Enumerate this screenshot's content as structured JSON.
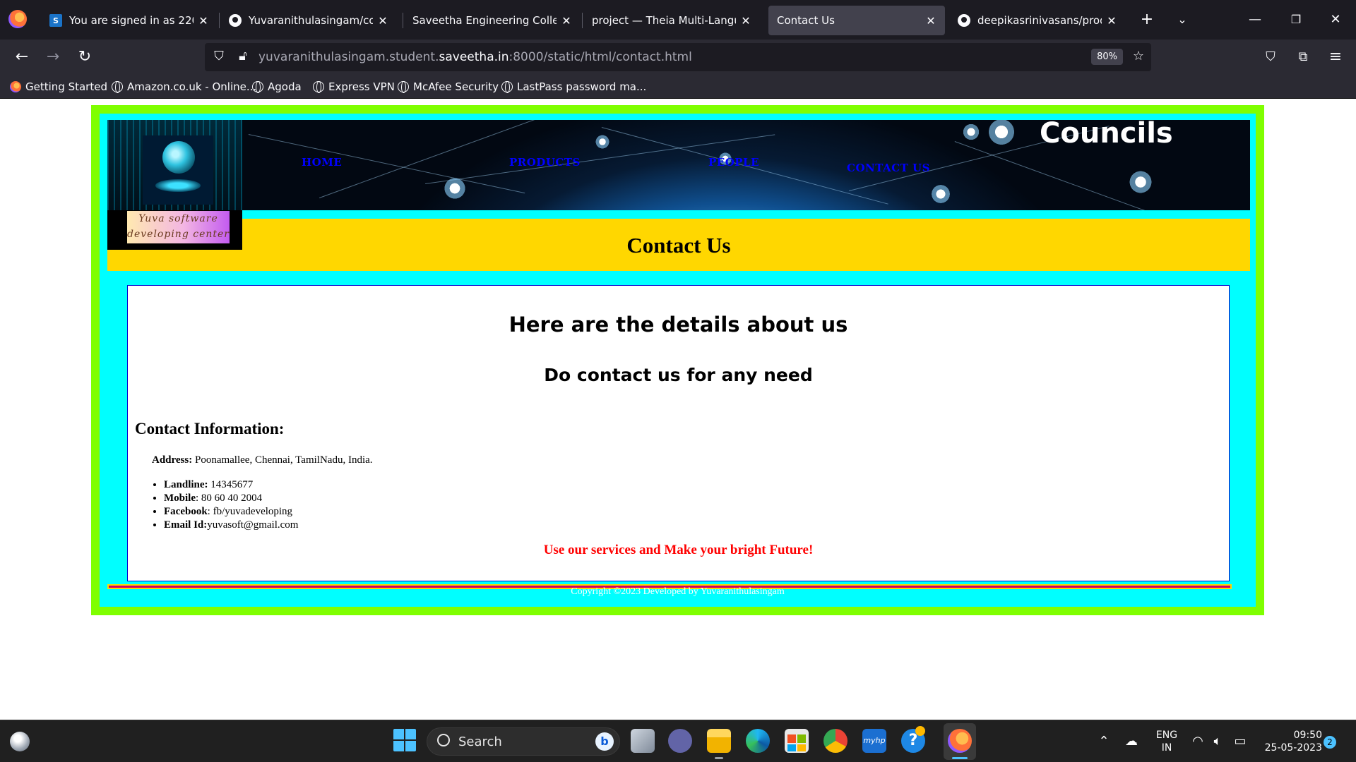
{
  "browser": {
    "tabs": [
      {
        "title": "You are signed in as 220090",
        "icon": "s-icon"
      },
      {
        "title": "Yuvaranithulasingam/cover",
        "icon": "github-icon"
      },
      {
        "title": "Saveetha Engineering College",
        "icon": "none"
      },
      {
        "title": "project — Theia Multi-Language",
        "icon": "none"
      },
      {
        "title": "Contact Us",
        "icon": "none"
      },
      {
        "title": "deepikasrinivasans/product",
        "icon": "github-icon"
      }
    ],
    "active_tab_index": 4,
    "url_prefix": "yuvaranithulasingam.student.",
    "url_domain": "saveetha.in",
    "url_suffix": ":8000/static/html/contact.html",
    "zoom": "80%",
    "bookmarks": [
      "Getting Started",
      "Amazon.co.uk - Online...",
      "Agoda",
      "Express VPN",
      "McAfee Security",
      "LastPass password ma..."
    ]
  },
  "page": {
    "banner_word": "Councils",
    "nav": {
      "home": "HOME",
      "products": "PRODUCTS",
      "people": "PEOPLE",
      "contact": "CONTACT US"
    },
    "logo_text_line1": "Yuva software",
    "logo_text_line2": "developing center",
    "title": "Contact Us",
    "heading": "Here are the details about us",
    "subheading": "Do contact us for any need",
    "contact_heading": "Contact Information:",
    "address_label": "Address:",
    "address_value": " Poonamallee, Chennai, TamilNadu, India.",
    "contacts": [
      {
        "label": "Landline:",
        "value": " 14345677"
      },
      {
        "label": "Mobile",
        "value": ": 80 60 40 2004"
      },
      {
        "label": "Facebook",
        "value": ": fb/yuvadeveloping"
      },
      {
        "label": "Email Id:",
        "value": "yuvasoft@gmail.com"
      }
    ],
    "tagline": "Use our services and Make your bright Future!",
    "copyright": "Copyright ©2023 Developed by Yuvaranithulasingam"
  },
  "taskbar": {
    "search_label": "Search",
    "lang_line1": "ENG",
    "lang_line2": "IN",
    "time": "09:50",
    "date": "25-05-2023",
    "notifications": "2"
  },
  "colors": {
    "outer_frame": "#7fff00",
    "inner_frame": "#00ffff",
    "title_bar": "#ffd700",
    "nav_link": "#0000ff",
    "tagline": "#ff0000"
  }
}
